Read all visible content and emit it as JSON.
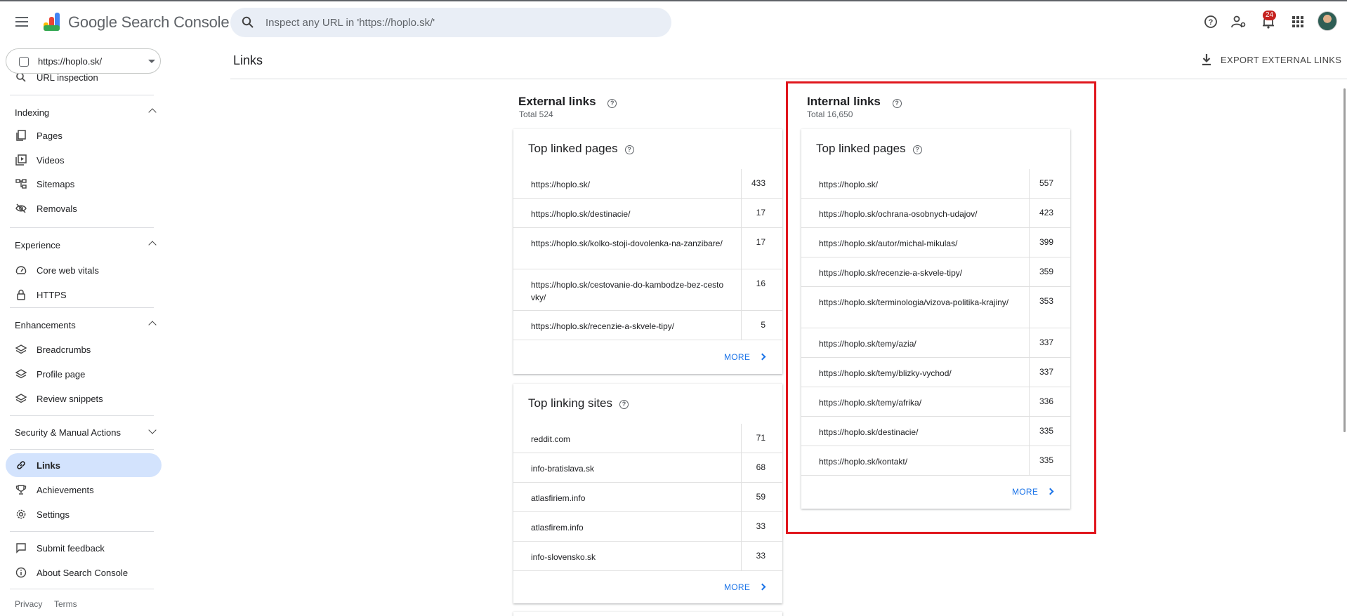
{
  "app": {
    "title": "Google Search Console"
  },
  "search": {
    "placeholder": "Inspect any URL in 'https://hoplo.sk/'"
  },
  "notifications": {
    "count": "24"
  },
  "property": {
    "label": "https://hoplo.sk/"
  },
  "sidebar": {
    "partial_item": "URL inspection",
    "sections": [
      {
        "title": "Indexing",
        "items": [
          "Pages",
          "Videos",
          "Sitemaps",
          "Removals"
        ]
      },
      {
        "title": "Experience",
        "items": [
          "Core web vitals",
          "HTTPS"
        ]
      },
      {
        "title": "Enhancements",
        "items": [
          "Breadcrumbs",
          "Profile page",
          "Review snippets"
        ]
      },
      {
        "title": "Security & Manual Actions",
        "items": []
      }
    ],
    "bottom_items": [
      "Links",
      "Achievements",
      "Settings"
    ],
    "feedback_items": [
      "Submit feedback",
      "About Search Console"
    ],
    "footer": {
      "privacy": "Privacy",
      "terms": "Terms"
    }
  },
  "page": {
    "title": "Links",
    "export_label": "EXPORT EXTERNAL LINKS"
  },
  "external": {
    "title": "External links",
    "total": "Total 524",
    "top_linked_pages": {
      "title": "Top linked pages",
      "rows": [
        {
          "url": "https://hoplo.sk/",
          "count": "433"
        },
        {
          "url": "https://hoplo.sk/destinacie/",
          "count": "17"
        },
        {
          "url": "https://hoplo.sk/kolko-stoji-dovolenka-na-zanzibare/",
          "count": "17"
        },
        {
          "url": "https://hoplo.sk/cestovanie-do-kambodze-bez-cestovky/",
          "count": "16"
        },
        {
          "url": "https://hoplo.sk/recenzie-a-skvele-tipy/",
          "count": "5"
        }
      ],
      "more": "MORE"
    },
    "top_linking_sites": {
      "title": "Top linking sites",
      "rows": [
        {
          "url": "reddit.com",
          "count": "71"
        },
        {
          "url": "info-bratislava.sk",
          "count": "68"
        },
        {
          "url": "atlasfiriem.info",
          "count": "59"
        },
        {
          "url": "atlasfirem.info",
          "count": "33"
        },
        {
          "url": "info-slovensko.sk",
          "count": "33"
        }
      ],
      "more": "MORE"
    }
  },
  "internal": {
    "title": "Internal links",
    "total": "Total 16,650",
    "top_linked_pages": {
      "title": "Top linked pages",
      "rows": [
        {
          "url": "https://hoplo.sk/",
          "count": "557"
        },
        {
          "url": "https://hoplo.sk/ochrana-osobnych-udajov/",
          "count": "423"
        },
        {
          "url": "https://hoplo.sk/autor/michal-mikulas/",
          "count": "399"
        },
        {
          "url": "https://hoplo.sk/recenzie-a-skvele-tipy/",
          "count": "359"
        },
        {
          "url": "https://hoplo.sk/terminologia/vizova-politika-krajiny/",
          "count": "353"
        },
        {
          "url": "https://hoplo.sk/temy/azia/",
          "count": "337"
        },
        {
          "url": "https://hoplo.sk/temy/blizky-vychod/",
          "count": "337"
        },
        {
          "url": "https://hoplo.sk/temy/afrika/",
          "count": "336"
        },
        {
          "url": "https://hoplo.sk/destinacie/",
          "count": "335"
        },
        {
          "url": "https://hoplo.sk/kontakt/",
          "count": "335"
        }
      ],
      "more": "MORE"
    }
  },
  "colors": {
    "accent": "#1a73e8",
    "active_nav": "#d3e3fd",
    "highlight": "#e0161d"
  }
}
